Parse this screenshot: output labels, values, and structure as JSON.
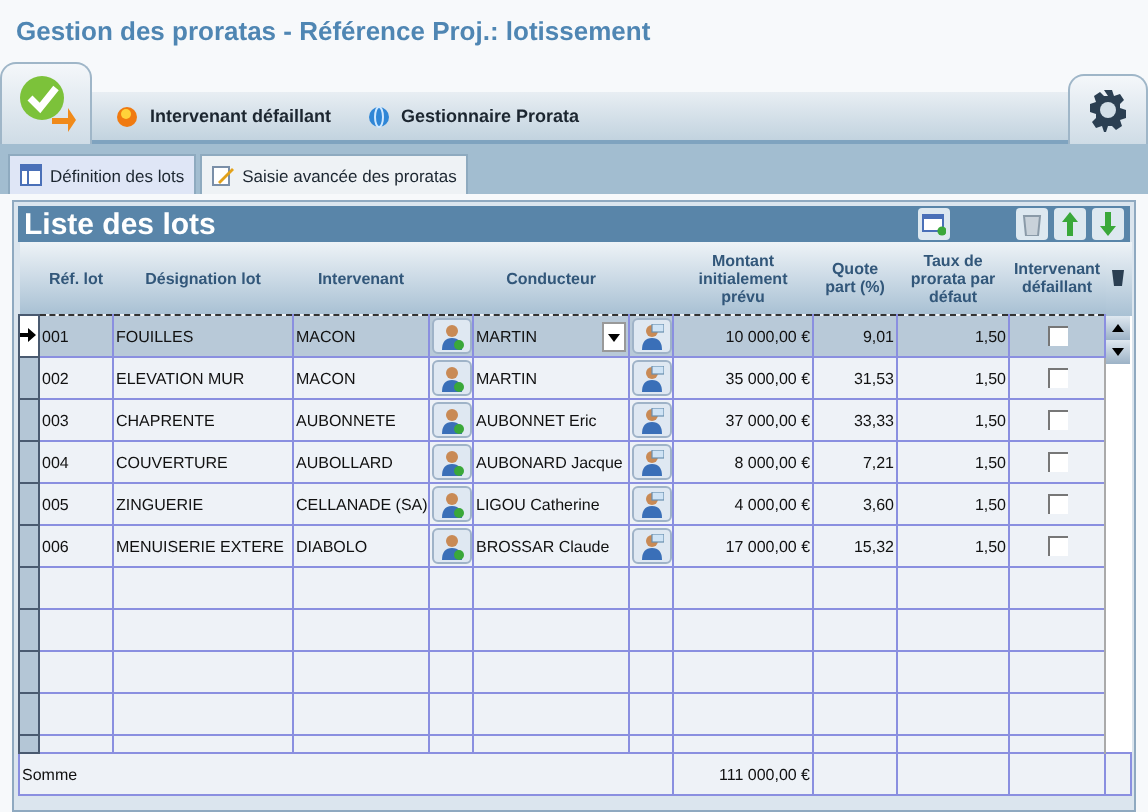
{
  "window": {
    "title": "Gestion des proratas - Référence Proj.: lotissement"
  },
  "toolbar": {
    "items": [
      {
        "label": "Intervenant défaillant",
        "kind": "warning"
      },
      {
        "label": "Gestionnaire Prorata",
        "kind": "globe"
      }
    ]
  },
  "tabs": [
    {
      "label": "Définition des lots",
      "kind": "grid",
      "selected": true
    },
    {
      "label": "Saisie avancée des proratas",
      "kind": "edit",
      "selected": false
    }
  ],
  "panel": {
    "title": "Liste des lots"
  },
  "table": {
    "columns": [
      "Réf. lot",
      "Désignation lot",
      "Intervenant",
      "Conducteur",
      "Montant initialement prévu",
      "Quote part (%)",
      "Taux de prorata par défaut",
      "Intervenant défaillant"
    ],
    "rows": [
      {
        "ref": "001",
        "designation": "FOUILLES",
        "intervenant": "MACON",
        "conducteur": "MARTIN",
        "montant": "10 000,00 €",
        "quote": "9,01",
        "taux": "1,50",
        "defaillant": false,
        "selected": true
      },
      {
        "ref": "002",
        "designation": "ELEVATION MUR",
        "intervenant": "MACON",
        "conducteur": "MARTIN",
        "montant": "35 000,00 €",
        "quote": "31,53",
        "taux": "1,50",
        "defaillant": false,
        "selected": false
      },
      {
        "ref": "003",
        "designation": "CHAPRENTE",
        "intervenant": "AUBONNETE",
        "conducteur": "AUBONNET Eric",
        "montant": "37 000,00 €",
        "quote": "33,33",
        "taux": "1,50",
        "defaillant": false,
        "selected": false
      },
      {
        "ref": "004",
        "designation": "COUVERTURE",
        "intervenant": "AUBOLLARD",
        "conducteur": "AUBONARD Jacque",
        "montant": "8 000,00 €",
        "quote": "7,21",
        "taux": "1,50",
        "defaillant": false,
        "selected": false
      },
      {
        "ref": "005",
        "designation": "ZINGUERIE",
        "intervenant": "CELLANADE (SA)",
        "conducteur": "LIGOU Catherine",
        "montant": "4 000,00 €",
        "quote": "3,60",
        "taux": "1,50",
        "defaillant": false,
        "selected": false
      },
      {
        "ref": "006",
        "designation": "MENUISERIE EXTERE",
        "intervenant": "DIABOLO",
        "conducteur": "BROSSAR Claude",
        "montant": "17 000,00 €",
        "quote": "15,32",
        "taux": "1,50",
        "defaillant": false,
        "selected": false
      }
    ],
    "footer": {
      "label": "Somme",
      "montant": "111 000,00 €"
    }
  }
}
